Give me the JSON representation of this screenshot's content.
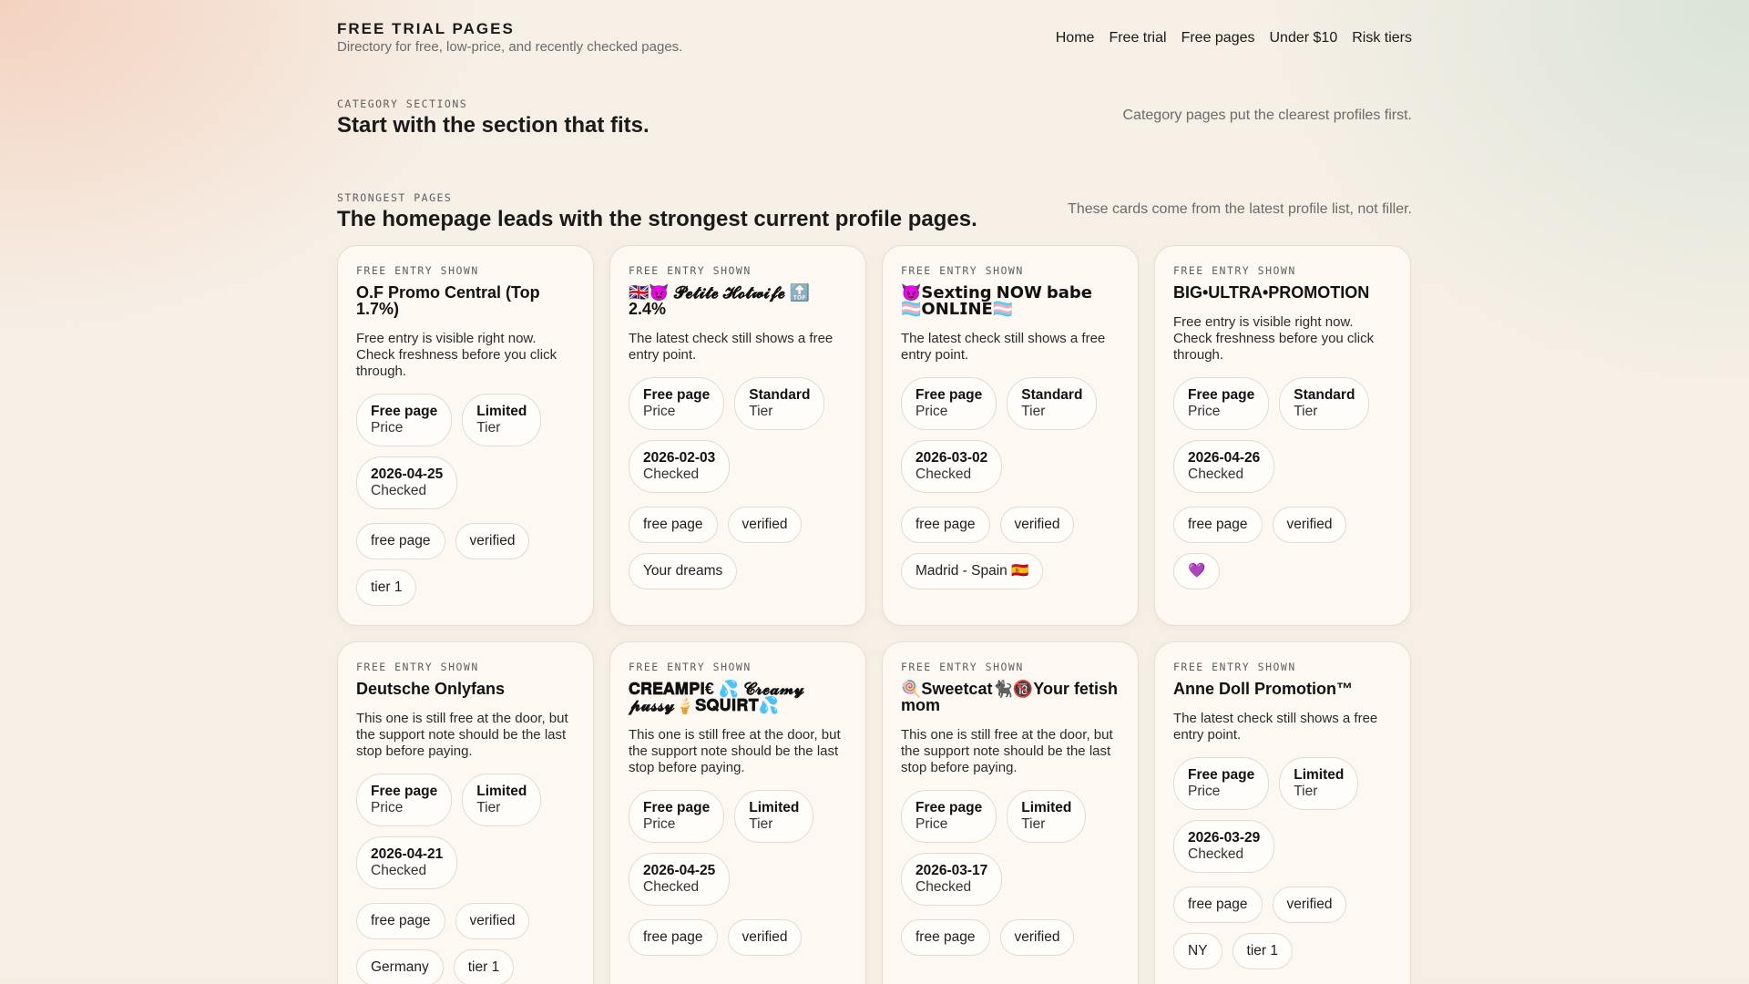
{
  "header": {
    "title": "FREE TRIAL PAGES",
    "subtitle": "Directory for free, low-price, and recently checked pages.",
    "nav": [
      "Home",
      "Free trial",
      "Free pages",
      "Under $10",
      "Risk tiers"
    ]
  },
  "category_section": {
    "eyebrow": "CATEGORY SECTIONS",
    "title": "Start with the section that fits.",
    "note": "Category pages put the clearest profiles first."
  },
  "strongest_section": {
    "eyebrow": "STRONGEST PAGES",
    "title": "The homepage leads with the strongest current profile pages.",
    "note": "These cards come from the latest profile list, not filler."
  },
  "cards": [
    {
      "eyebrow": "FREE ENTRY SHOWN",
      "title": "O.F Promo Central (Top 1.7%)",
      "desc": "Free entry is visible right now. Check freshness before you click through.",
      "price_value": "Free page",
      "price_label": "Price",
      "tier_value": "Limited",
      "tier_label": "Tier",
      "checked_value": "2026-04-25",
      "checked_label": "Checked",
      "tags": [
        "free page",
        "verified",
        "tier 1"
      ]
    },
    {
      "eyebrow": "FREE ENTRY SHOWN",
      "title": "🇬🇧😈 𝓟𝓮𝓽𝓲𝓽𝓮 𝓗𝓸𝓽𝔀𝓲𝓯𝓮 🔝 2.4%",
      "desc": "The latest check still shows a free entry point.",
      "price_value": "Free page",
      "price_label": "Price",
      "tier_value": "Standard",
      "tier_label": "Tier",
      "checked_value": "2026-02-03",
      "checked_label": "Checked",
      "tags": [
        "free page",
        "verified",
        "Your dreams"
      ]
    },
    {
      "eyebrow": "FREE ENTRY SHOWN",
      "title": "😈𝗦𝗲𝘅𝘁𝗶𝗻𝗴 𝗡𝗢𝗪 𝗯𝗮𝗯𝗲 🏳️‍⚧️𝗢𝗡𝗟𝗜𝗡𝗘🏳️‍⚧️",
      "desc": "The latest check still shows a free entry point.",
      "price_value": "Free page",
      "price_label": "Price",
      "tier_value": "Standard",
      "tier_label": "Tier",
      "checked_value": "2026-03-02",
      "checked_label": "Checked",
      "tags": [
        "free page",
        "verified",
        "Madrid - Spain 🇪🇸"
      ]
    },
    {
      "eyebrow": "FREE ENTRY SHOWN",
      "title": "BIG•ULTRA•PROMOTION",
      "desc": "Free entry is visible right now. Check freshness before you click through.",
      "price_value": "Free page",
      "price_label": "Price",
      "tier_value": "Standard",
      "tier_label": "Tier",
      "checked_value": "2026-04-26",
      "checked_label": "Checked",
      "tags": [
        "free page",
        "verified",
        "💜"
      ]
    },
    {
      "eyebrow": "FREE ENTRY SHOWN",
      "title": "Deutsche Onlyfans",
      "desc": "This one is still free at the door, but the support note should be the last stop before paying.",
      "price_value": "Free page",
      "price_label": "Price",
      "tier_value": "Limited",
      "tier_label": "Tier",
      "checked_value": "2026-04-21",
      "checked_label": "Checked",
      "tags": [
        "free page",
        "verified",
        "Germany",
        "tier 1"
      ]
    },
    {
      "eyebrow": "FREE ENTRY SHOWN",
      "title": "𝐂𝐑𝐄𝐀𝐌𝐏𝐈€ 💦 𝓒𝓻𝓮𝓪𝓶𝔂 𝓹𝓾𝓼𝓼𝔂🍦𝐒𝐐𝐔𝐈𝐑𝐓💦",
      "desc": "This one is still free at the door, but the support note should be the last stop before paying.",
      "price_value": "Free page",
      "price_label": "Price",
      "tier_value": "Limited",
      "tier_label": "Tier",
      "checked_value": "2026-04-25",
      "checked_label": "Checked",
      "tags": [
        "free page",
        "verified"
      ]
    },
    {
      "eyebrow": "FREE ENTRY SHOWN",
      "title": "🍭Sweetcat🐈‍⬛🔞Your fetish mom",
      "desc": "This one is still free at the door, but the support note should be the last stop before paying.",
      "price_value": "Free page",
      "price_label": "Price",
      "tier_value": "Limited",
      "tier_label": "Tier",
      "checked_value": "2026-03-17",
      "checked_label": "Checked",
      "tags": [
        "free page",
        "verified"
      ]
    },
    {
      "eyebrow": "FREE ENTRY SHOWN",
      "title": "Anne Doll Promotion™",
      "desc": "The latest check still shows a free entry point.",
      "price_value": "Free page",
      "price_label": "Price",
      "tier_value": "Limited",
      "tier_label": "Tier",
      "checked_value": "2026-03-29",
      "checked_label": "Checked",
      "tags": [
        "free page",
        "verified",
        "NY",
        "tier 1"
      ]
    }
  ]
}
